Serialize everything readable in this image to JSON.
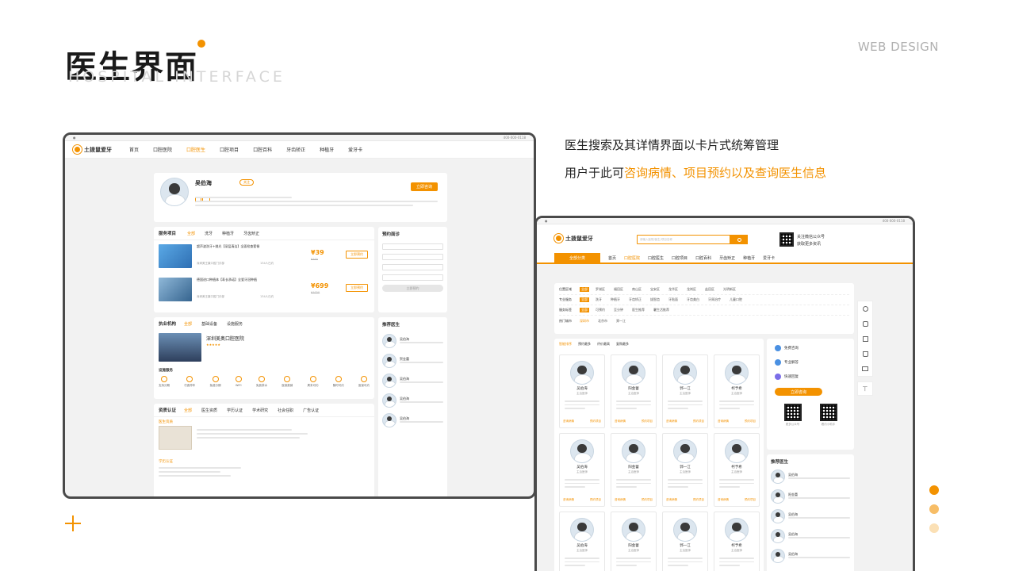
{
  "header": {
    "title": "医生界面",
    "subtitle_en": "HOSPITAL INTERFACE",
    "web_design": "WEB DESIGN"
  },
  "description": {
    "line1": "医生搜索及其详情界面以卡片式统筹管理",
    "line2_prefix": "用户于此可",
    "line2_highlight": "咨询病情、项目预约以及查询医生信息"
  },
  "colors": {
    "accent": "#f39200",
    "frame": "#4a4a4a",
    "subtitle": "#d6d6d6"
  },
  "dots_colors": [
    "#f39200",
    "#f7bd66",
    "#fbe0b5"
  ],
  "site": {
    "logo_text": "土拨鼠爱牙",
    "hotline": "400-000-0118",
    "nav": [
      "首页",
      "口腔医院",
      "口腔医生",
      "口腔项目",
      "口腔百科",
      "牙齿矫正",
      "种植牙",
      "爱牙卡"
    ],
    "right_nav": [
      "全部分类",
      "首页",
      "口腔医院",
      "口腔医生",
      "口腔项目",
      "口腔百科",
      "牙齿矫正",
      "种植牙",
      "爱牙卡"
    ],
    "search_button_icon": "search-icon"
  },
  "detail": {
    "doctor_name": "吴伯海",
    "follow": "关注",
    "consult_button": "立即咨询",
    "service_section": "服务项目",
    "service_tabs": [
      "全部",
      "洗牙",
      "种植牙",
      "牙齿矫正"
    ],
    "services": [
      {
        "title": "超声波洗牙+抛光【深层清洁】全面检查套餐",
        "price": "¥39",
        "old_price": "¥102",
        "clinic": "深圳美王康口腔门诊部",
        "sold": "134人已约",
        "button": "立即预约"
      },
      {
        "title": "德国进口种植体【寿长承诺】全瓷牙冠种植",
        "price": "¥699",
        "old_price": "¥1020",
        "clinic": "深圳美王康口腔门诊部",
        "sold": "134人已约",
        "button": "立即预约"
      }
    ],
    "booking_section": "预约面诊",
    "booking_submit": "立即预约",
    "org_section": "执业机构",
    "org_tabs": [
      "全部",
      "基础设备",
      "设施服务"
    ],
    "org_name": "深圳美奥口腔医院",
    "facility_section": "设施服务",
    "facilities": [
      "支持分期",
      "付费停车",
      "免费分期",
      "WIFI",
      "免费茶水",
      "医保报销",
      "周末可约",
      "随时可约",
      "医保可约"
    ],
    "cert_section": "资质认证",
    "cert_tabs": [
      "全部",
      "医生资质",
      "学历认证",
      "学术研究",
      "社会任职",
      "广告认证"
    ],
    "cert_title": "医生资质",
    "edu_title": "学历认证",
    "recommend_section": "推荐医生",
    "recommended": [
      "吴伯海",
      "贺金蕾",
      "吴伯海",
      "吴伯海",
      "吴伯海"
    ]
  },
  "search": {
    "placeholder": "请输入医院/医生/项目名称",
    "qr_text1": "关注微信公众号",
    "qr_text2": "获取更多资讯",
    "filters": [
      {
        "label": "位置区域",
        "all": "全部",
        "options": [
          "罗湖区",
          "福田区",
          "南山区",
          "宝安区",
          "龙华区",
          "龙岗区",
          "盐田区",
          "光明新区"
        ]
      },
      {
        "label": "专业服务",
        "all": "全部",
        "options": [
          "洗牙",
          "种植牙",
          "牙齿矫正",
          "拔智齿",
          "牙贴面",
          "牙齿美白",
          "牙周治疗",
          "儿童口腔"
        ]
      },
      {
        "label": "服务标签",
        "all": "全部",
        "options": [
          "可预约",
          "至分钟",
          "医生推荐",
          "暑生活推荐"
        ]
      },
      {
        "label": "热门城市",
        "all": "深圳市",
        "options": [
          "北京市",
          "郑一江"
        ]
      }
    ],
    "sort_tabs": [
      "智能排序",
      "预约最多",
      "评价最高",
      "复购最多"
    ],
    "doctor_names": [
      "吴伯海",
      "阳金蕾",
      "郭一江",
      "柯予希"
    ],
    "doctor_title": "主治医师",
    "card_actions": [
      "咨询病情",
      "预约项目"
    ],
    "side_actions": [
      "免费咨询",
      "专业解答",
      "快速回复"
    ],
    "side_button": "立即咨询",
    "side_qr": [
      "更多公众号",
      "看约小助手"
    ],
    "recommend_section": "推荐医生",
    "recommended": [
      "吴伯海",
      "阳金蕾",
      "吴伯海",
      "吴伯海",
      "吴伯海"
    ]
  }
}
